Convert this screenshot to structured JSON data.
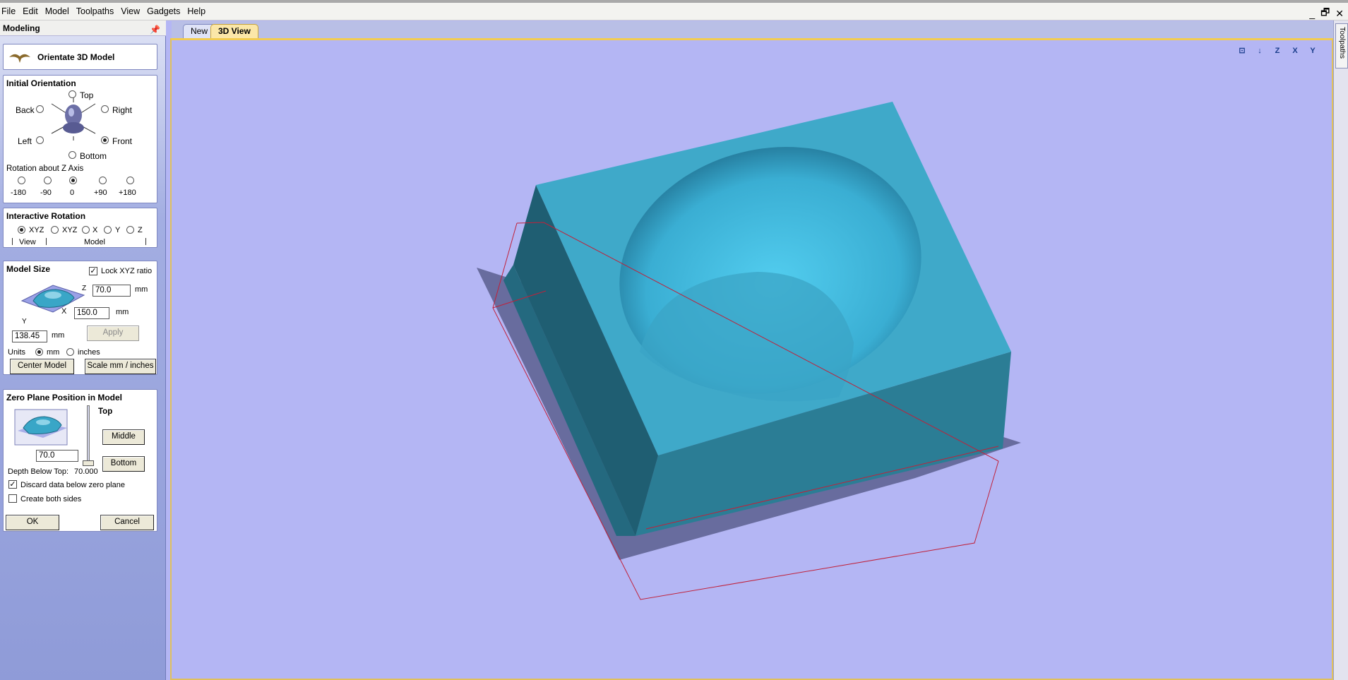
{
  "menu": [
    "File",
    "Edit",
    "Model",
    "Toolpaths",
    "View",
    "Gadgets",
    "Help"
  ],
  "window_controls": [
    "_",
    "🗗",
    "✕"
  ],
  "panel": {
    "title": "Modeling",
    "pin_glyph": "📌",
    "page_title": "Orientate 3D Model",
    "initial_orientation": {
      "heading": "Initial Orientation",
      "top": "Top",
      "back": "Back",
      "right": "Right",
      "left": "Left",
      "front": "Front",
      "bottom": "Bottom",
      "rotation_label": "Rotation about Z Axis",
      "rotations": [
        "-180",
        "-90",
        "0",
        "+90",
        "+180"
      ],
      "selected_rotation": "0",
      "selected_orientation": "Front"
    },
    "interactive_rotation": {
      "heading": "Interactive Rotation",
      "options": [
        "XYZ",
        "XYZ",
        "X",
        "Y",
        "Z"
      ],
      "view_label": "View",
      "model_label": "Model"
    },
    "model_size": {
      "heading": "Model Size",
      "lock_label": "Lock XYZ ratio",
      "z_label": "Z",
      "x_label": "X",
      "y_label": "Y",
      "z_value": "70.0",
      "x_value": "150.0",
      "y_value": "138.45",
      "unit": "mm",
      "apply": "Apply",
      "units_label": "Units",
      "unit_mm": "mm",
      "unit_inches": "inches",
      "center_model": "Center Model",
      "scale": "Scale mm / inches"
    },
    "zero_plane": {
      "heading": "Zero Plane Position in Model",
      "top": "Top",
      "middle": "Middle",
      "bottom": "Bottom",
      "value": "70.0",
      "depth_label": "Depth Below Top:",
      "depth_value": "70.000",
      "discard_label": "Discard data below zero plane",
      "both_label": "Create both sides"
    },
    "ok": "OK",
    "cancel": "Cancel"
  },
  "tabs": [
    "New",
    "3D View"
  ],
  "toolpaths_tab": "Toolpaths",
  "view_icons": [
    "⊡",
    "↓",
    "Z",
    "X",
    "Y"
  ],
  "colors": {
    "viewport_bg": "#b4b6f4",
    "model": "#3fa9c9",
    "bounding_box": "#c0213a"
  }
}
